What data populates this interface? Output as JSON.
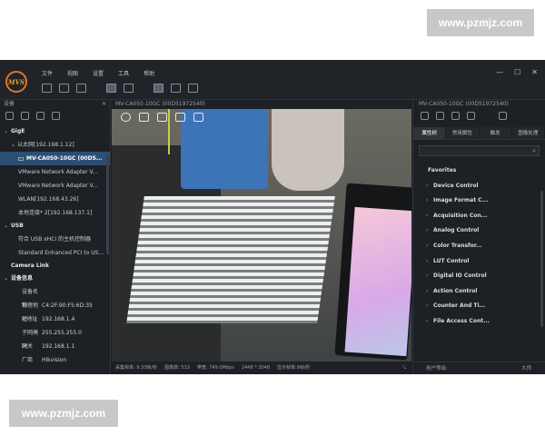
{
  "watermark": {
    "top": "www.pzmjz.com",
    "bottom": "www.pzmjz.com"
  },
  "app": {
    "logo": "MVS",
    "menu": [
      "文件",
      "视图",
      "设置",
      "工具",
      "帮助"
    ],
    "window_controls": [
      "—",
      "☐",
      "✕"
    ]
  },
  "left_panel": {
    "title": "设备",
    "close": "✕",
    "sections": {
      "gige": "GigE",
      "usb": "USB",
      "camera_link": "Camera Link",
      "device_info": "设备信息"
    },
    "gige_items": [
      "以太网[192.168.1.12]",
      "MV-CA050-10GC (00D5...",
      "VMware Network Adapter V...",
      "VMware Network Adapter V...",
      "WLAN[192.168.43.26]",
      "本地连接* 2[192.168.137.1]"
    ],
    "usb_items": [
      "符合 USB xHCI 的主机控制器",
      "Standard Enhanced PCI to US..."
    ],
    "device_info": [
      {
        "k": "设备名称",
        "v": ""
      },
      {
        "k": "物理地址",
        "v": "C4:2F:90:F5:6D:35"
      },
      {
        "k": "IP地址",
        "v": "192.168.1.4"
      },
      {
        "k": "子网掩码",
        "v": "255.255.255.0"
      },
      {
        "k": "网关",
        "v": "192.168.1.1"
      },
      {
        "k": "厂商",
        "v": "Hikvision"
      }
    ]
  },
  "center_panel": {
    "title": "MV-CA050-10GC (00D51972540)",
    "status": {
      "fps_label": "采集帧率:",
      "fps": "9.33帧/秒",
      "images_label": "图像数:",
      "images": "513",
      "bandwidth_label": "带宽:",
      "bandwidth": "749.0Mbps",
      "resolution": "2448 * 2048",
      "display_fps_label": "显示帧率:",
      "display_fps": "9帧/秒"
    }
  },
  "right_panel": {
    "title": "MV-CA050-10GC (00D51972540)",
    "tabs": [
      "属性树",
      "常用属性",
      "触发",
      "图像处理"
    ],
    "favorites": "Favorites",
    "properties": [
      "Device Control",
      "Image Format C...",
      "Acquisition Con...",
      "Analog Control",
      "Color Transfor...",
      "LUT Control",
      "Digital IO Control",
      "Action Control",
      "Counter And Ti...",
      "File Access Cont..."
    ],
    "user_level_label": "用户等级:",
    "user_level": "大师"
  },
  "colors": {
    "accent": "#2b4f74",
    "background": "#1a1d21",
    "logo_ring": "#e0762a"
  }
}
